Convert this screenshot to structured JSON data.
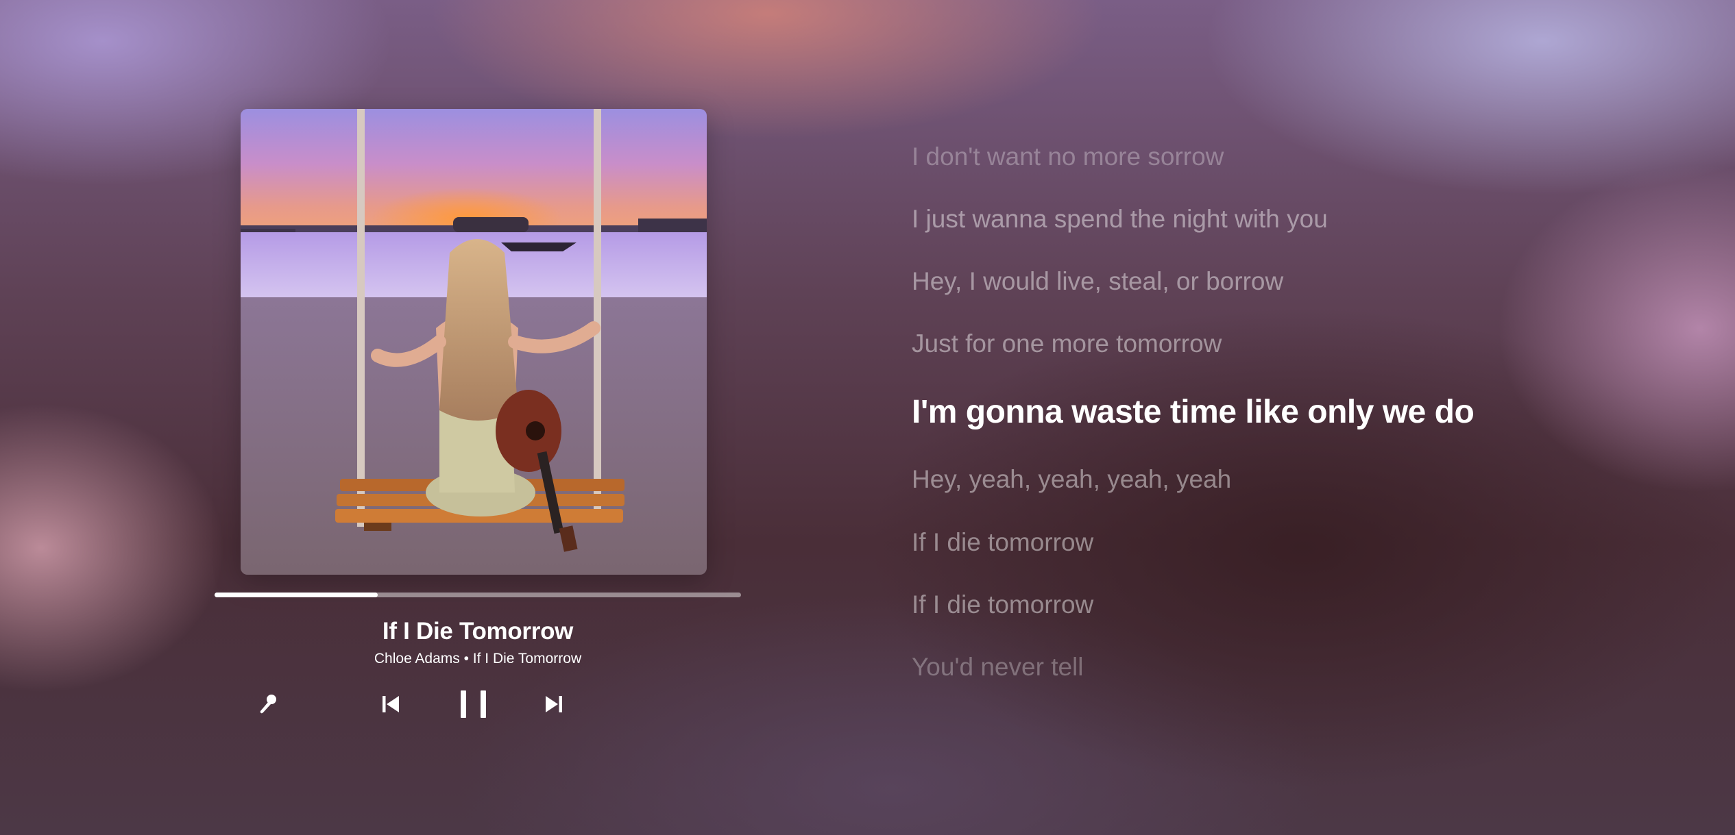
{
  "player": {
    "album_art": {
      "alt": "Woman on a beach swing at sunset with a ukulele",
      "icon": "album-cover-image"
    },
    "progress": 0.31,
    "track_title": "If I Die Tomorrow",
    "track_subtitle": "Chloe Adams • If I Die Tomorrow",
    "controls": {
      "lyrics_icon": "microphone-icon",
      "previous_icon": "skip-previous-icon",
      "play_pause_icon": "pause-icon",
      "next_icon": "skip-next-icon"
    }
  },
  "lyrics": [
    {
      "text": "I don't want no more sorrow",
      "state": "past-faint"
    },
    {
      "text": "I just wanna spend the night with you",
      "state": "past"
    },
    {
      "text": "Hey, I would live, steal, or borrow",
      "state": "past"
    },
    {
      "text": "Just for one more tomorrow",
      "state": "past"
    },
    {
      "text": "I'm gonna waste time like only we do",
      "state": "active"
    },
    {
      "text": "Hey, yeah, yeah, yeah, yeah",
      "state": "upcoming"
    },
    {
      "text": "If I die tomorrow",
      "state": "upcoming"
    },
    {
      "text": "If I die tomorrow",
      "state": "upcoming"
    },
    {
      "text": "You'd never tell",
      "state": "upcoming-faint"
    }
  ],
  "colors": {
    "text_active": "#ffffff",
    "text_inactive": "rgba(255,255,255,0.45)",
    "progress_fill": "#ffffff",
    "progress_track": "rgba(255,255,255,0.45)"
  }
}
